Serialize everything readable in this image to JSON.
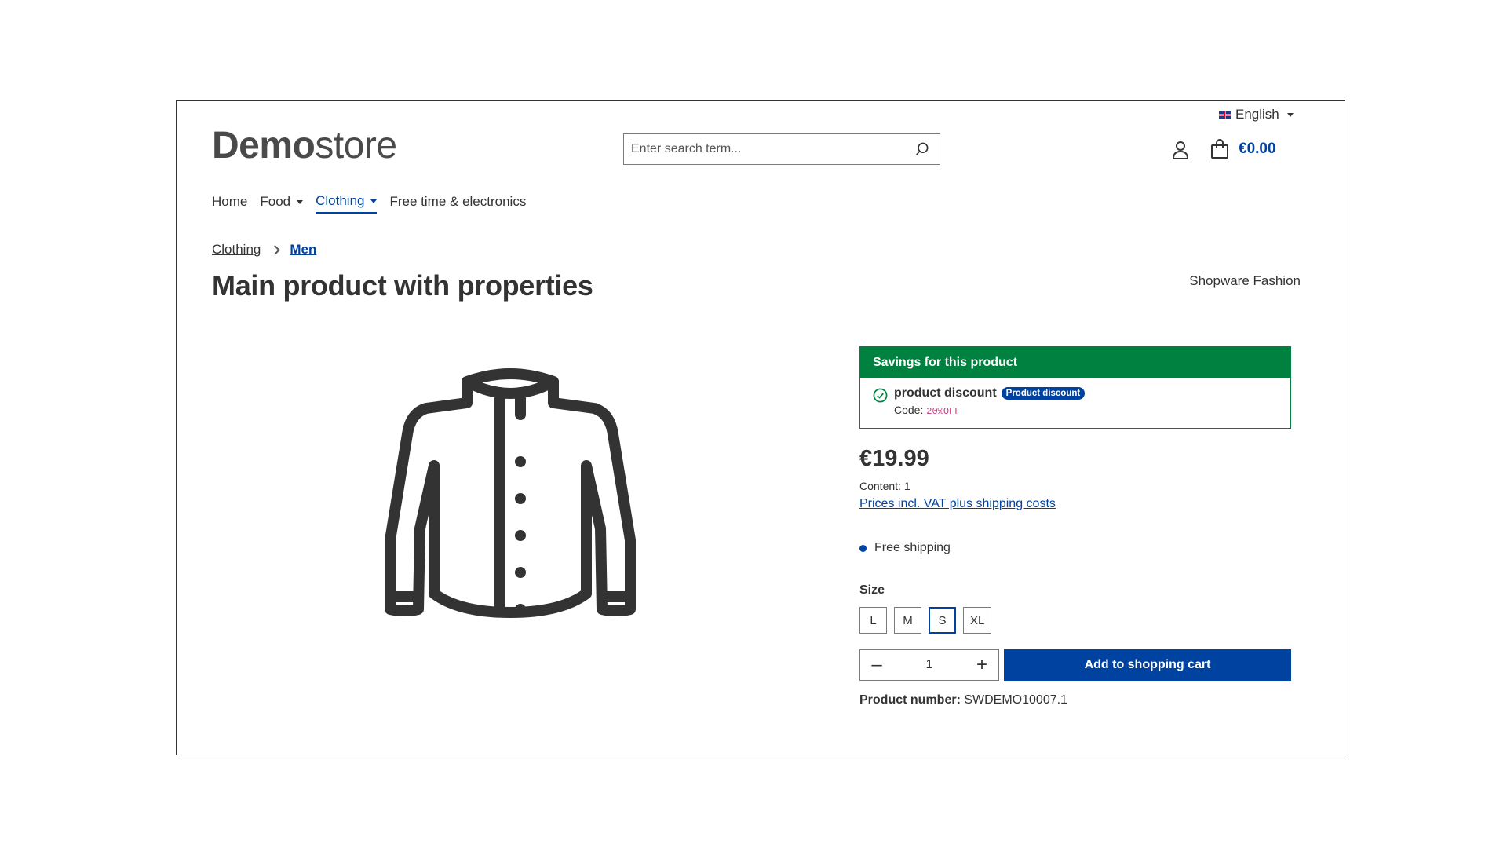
{
  "header": {
    "language": "English",
    "logo": {
      "bold": "Demo",
      "light": "store"
    },
    "search": {
      "placeholder": "Enter search term..."
    },
    "cart_total": "€0.00",
    "icons": {
      "search": "search-icon",
      "account": "account-icon",
      "cart": "shopping-bag-icon"
    }
  },
  "nav": {
    "items": [
      {
        "label": "Home",
        "dropdown": false
      },
      {
        "label": "Food",
        "dropdown": true
      },
      {
        "label": "Clothing",
        "dropdown": true,
        "active": true
      },
      {
        "label": "Free time & electronics",
        "dropdown": false
      }
    ]
  },
  "breadcrumb": [
    "Clothing",
    "Men"
  ],
  "product": {
    "title": "Main product with properties",
    "manufacturer": "Shopware Fashion",
    "image_icon": "jacket-icon",
    "savings": {
      "heading": "Savings for this product",
      "discount_name": "product discount",
      "badge": "Product discount",
      "code_label": "Code:",
      "code": "20%OFF"
    },
    "price": "€19.99",
    "content": "Content: 1",
    "vat_link": "Prices incl. VAT plus shipping costs",
    "shipping": "Free shipping",
    "size_label": "Size",
    "sizes": [
      "L",
      "M",
      "S",
      "XL"
    ],
    "selected_size": "S",
    "quantity": "1",
    "add_to_cart": "Add to shopping cart",
    "product_number_label": "Product number:",
    "product_number": "SWDEMO10007.1"
  },
  "colors": {
    "primary": "#0042a0",
    "success": "#00813f",
    "text": "#333333"
  }
}
